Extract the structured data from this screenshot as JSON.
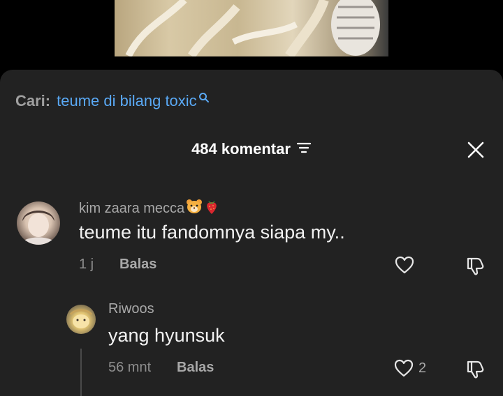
{
  "search": {
    "prefix": "Cari:",
    "term": "teume di bilang toxic"
  },
  "header": {
    "count_label": "484 komentar"
  },
  "comments": [
    {
      "username": "kim zaara mecca",
      "emojis": [
        "tiger-face-emoji",
        "strawberry-emoji"
      ],
      "text": "teume itu fandomnya siapa my..",
      "time": "1 j",
      "reply_label": "Balas"
    }
  ],
  "replies": [
    {
      "username": "Riwoos",
      "text": "yang hyunsuk",
      "time": "56 mnt",
      "reply_label": "Balas",
      "like_count": "2"
    }
  ],
  "colors": {
    "sheet_bg": "#222222",
    "link_blue": "#5aa9f5",
    "muted": "#a8a8a8"
  }
}
